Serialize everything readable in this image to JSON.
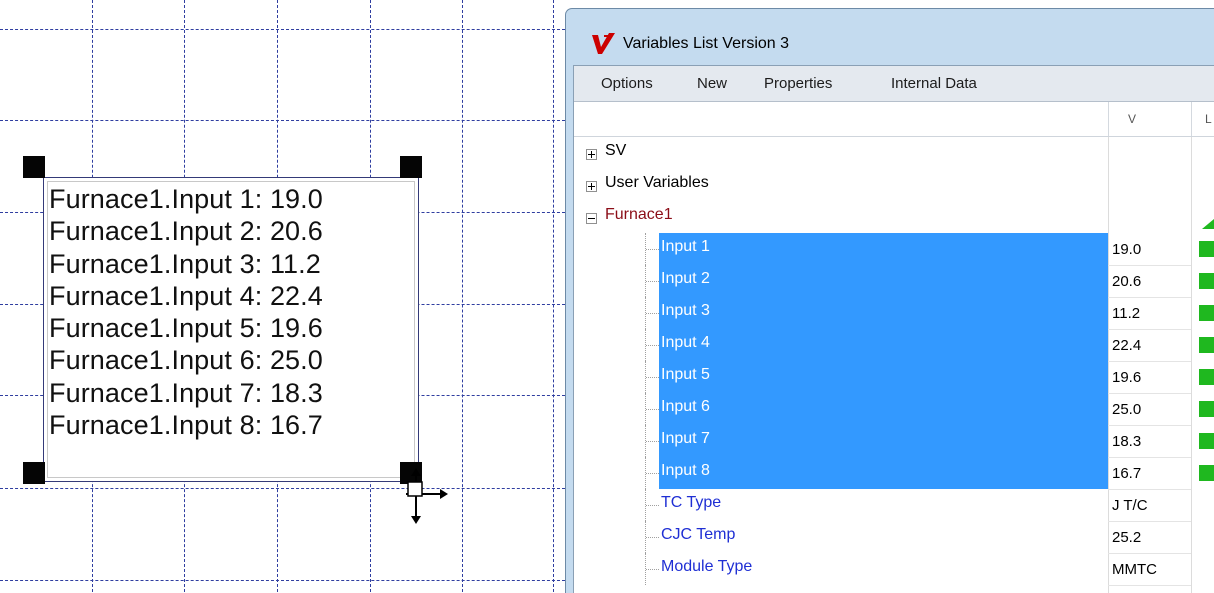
{
  "canvas": {
    "text_lines": [
      "Furnace1.Input 1: 19.0",
      "Furnace1.Input 2: 20.6",
      "Furnace1.Input 3: 11.2",
      "Furnace1.Input 4: 22.4",
      "Furnace1.Input 5: 19.6",
      "Furnace1.Input 6: 25.0",
      "Furnace1.Input 7: 18.3",
      "Furnace1.Input 8: 16.7"
    ]
  },
  "window": {
    "title": "Variables List Version 3",
    "icon": "v-app-icon",
    "menu": [
      "Options",
      "New",
      "Properties",
      "Internal Data"
    ],
    "columns": [
      "V",
      "L"
    ],
    "tree": {
      "groups": [
        {
          "label": "SV",
          "expanded": false
        },
        {
          "label": "User Variables",
          "expanded": false
        },
        {
          "label": "Furnace1",
          "expanded": true
        }
      ],
      "inputs": [
        {
          "label": "Input 1",
          "value": "19.0",
          "selected": true
        },
        {
          "label": "Input 2",
          "value": "20.6",
          "selected": true
        },
        {
          "label": "Input 3",
          "value": "11.2",
          "selected": true
        },
        {
          "label": "Input 4",
          "value": "22.4",
          "selected": true
        },
        {
          "label": "Input 5",
          "value": "19.6",
          "selected": true
        },
        {
          "label": "Input 6",
          "value": "25.0",
          "selected": true
        },
        {
          "label": "Input 7",
          "value": "18.3",
          "selected": true
        },
        {
          "label": "Input 8",
          "value": "16.7",
          "selected": true
        }
      ],
      "properties": [
        {
          "label": "TC Type",
          "value": "J T/C"
        },
        {
          "label": "CJC Temp",
          "value": "25.2"
        },
        {
          "label": "Module Type",
          "value": "MMTC"
        }
      ]
    }
  },
  "colors": {
    "selection": "#3399ff",
    "group_label": "#8b0d17",
    "child_label": "#1f2fd4",
    "status_ok": "#1fb81f",
    "grid": "#2f3ea0"
  }
}
